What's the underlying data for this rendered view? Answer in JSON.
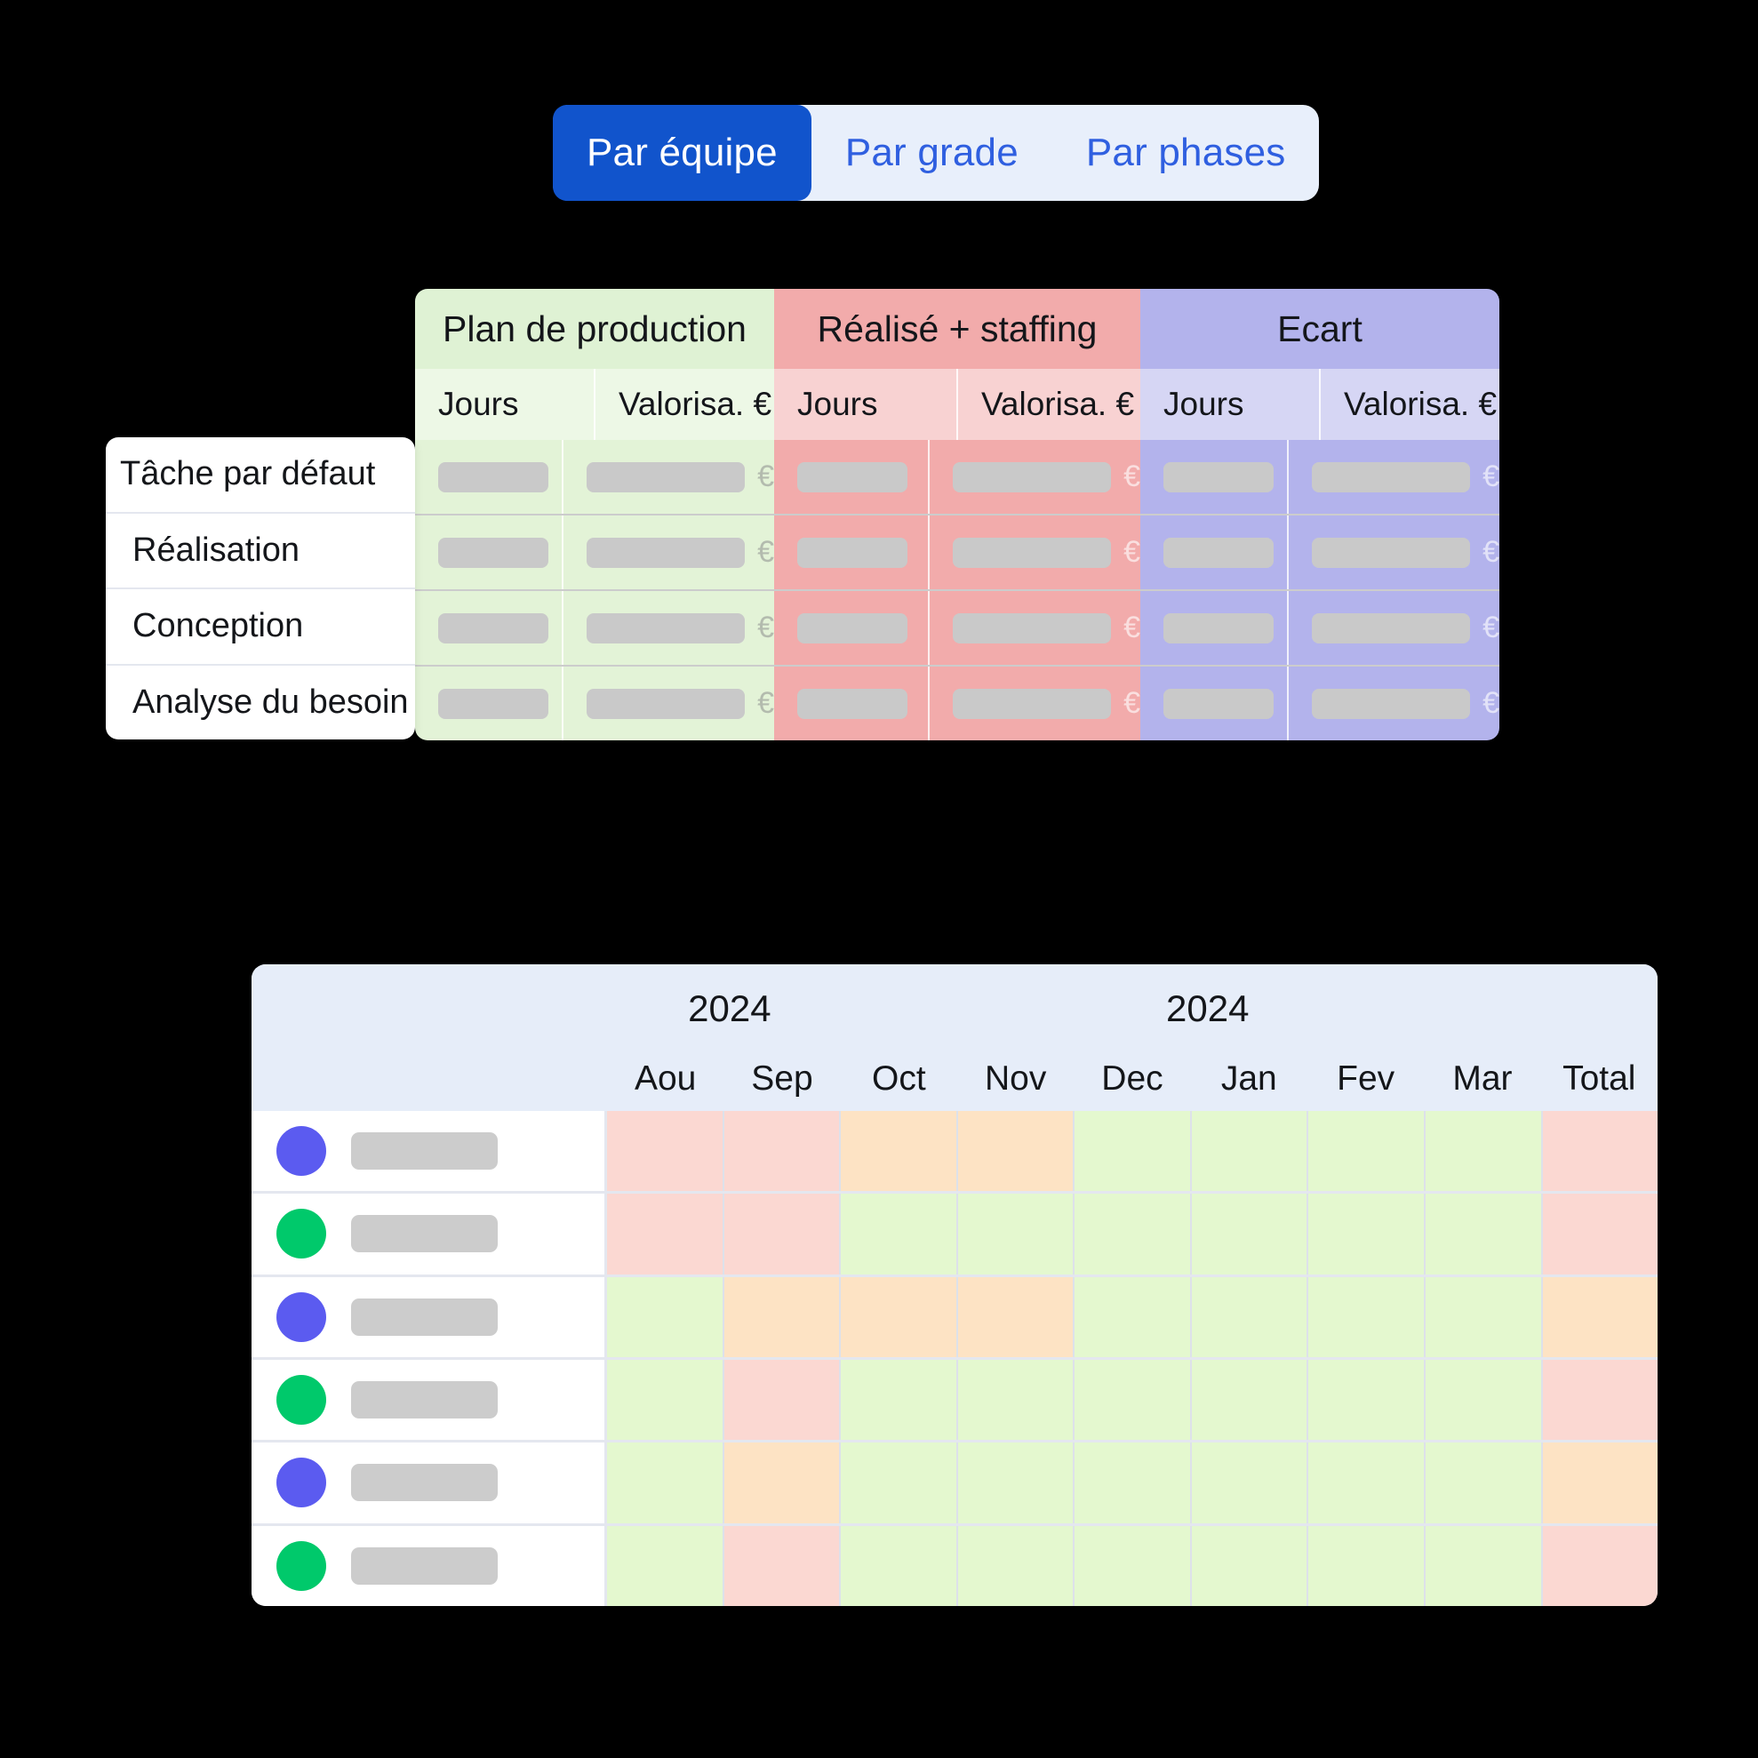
{
  "tabs": {
    "items": [
      {
        "label": "Par équipe",
        "active": true
      },
      {
        "label": "Par grade",
        "active": false
      },
      {
        "label": "Par phases",
        "active": false
      }
    ]
  },
  "colors": {
    "accent_blue": "#1154CC",
    "tab_bar_bg": "#E8EFFB",
    "tab_inactive_text": "#2F5FE0",
    "green_header": "#DFF2D4",
    "green_sub": "#EDF8E6",
    "green_cell": "#E3F3D7",
    "red_header": "#F2ABAB",
    "red_sub": "#F8D2D2",
    "red_cell": "#F2ABAB",
    "purple_header": "#B3B3EC",
    "purple_sub": "#D6D6F4",
    "purple_cell": "#B3B3EC",
    "timeline_header_bg": "#E6EDF9",
    "status_pink": "#FBD8D2",
    "status_orange": "#FDE3C4",
    "status_green": "#E4F8CF",
    "dot_purple": "#5B5BF0",
    "dot_green": "#00C96B",
    "placeholder_gray": "#C9C9C9"
  },
  "top_table": {
    "groups": [
      {
        "key": "plan",
        "title": "Plan de production",
        "columns": [
          "Jours",
          "Valorisa. €"
        ]
      },
      {
        "key": "real",
        "title": "Réalisé + staffing",
        "columns": [
          "Jours",
          "Valorisa. €"
        ]
      },
      {
        "key": "ecart",
        "title": "Ecart",
        "columns": [
          "Jours",
          "Valorisa. €"
        ]
      }
    ],
    "row_labels": [
      {
        "label": "Tâche par défaut",
        "level": 0
      },
      {
        "label": "Réalisation",
        "level": 1
      },
      {
        "label": "Conception",
        "level": 1
      },
      {
        "label": "Analyse du besoin",
        "level": 1
      }
    ],
    "currency_symbol": "€",
    "row_count": 4
  },
  "timeline": {
    "years": [
      {
        "label": "2024",
        "center_pct": 34
      },
      {
        "label": "2024",
        "center_pct": 68
      }
    ],
    "months": [
      "Aou",
      "Sep",
      "Oct",
      "Nov",
      "Dec",
      "Jan",
      "Fev",
      "Mar",
      "Total"
    ],
    "rows": [
      {
        "dot": "purple",
        "cells": [
          "pink",
          "pink",
          "orange",
          "orange",
          "green",
          "green",
          "green",
          "green",
          "pink"
        ]
      },
      {
        "dot": "green",
        "cells": [
          "pink",
          "pink",
          "green",
          "green",
          "green",
          "green",
          "green",
          "green",
          "pink"
        ]
      },
      {
        "dot": "purple",
        "cells": [
          "green",
          "orange",
          "orange",
          "orange",
          "green",
          "green",
          "green",
          "green",
          "orange"
        ]
      },
      {
        "dot": "green",
        "cells": [
          "green",
          "pink",
          "green",
          "green",
          "green",
          "green",
          "green",
          "green",
          "pink"
        ]
      },
      {
        "dot": "purple",
        "cells": [
          "green",
          "orange",
          "green",
          "green",
          "green",
          "green",
          "green",
          "green",
          "orange"
        ]
      },
      {
        "dot": "green",
        "cells": [
          "green",
          "pink",
          "green",
          "green",
          "green",
          "green",
          "green",
          "green",
          "pink"
        ]
      }
    ]
  }
}
